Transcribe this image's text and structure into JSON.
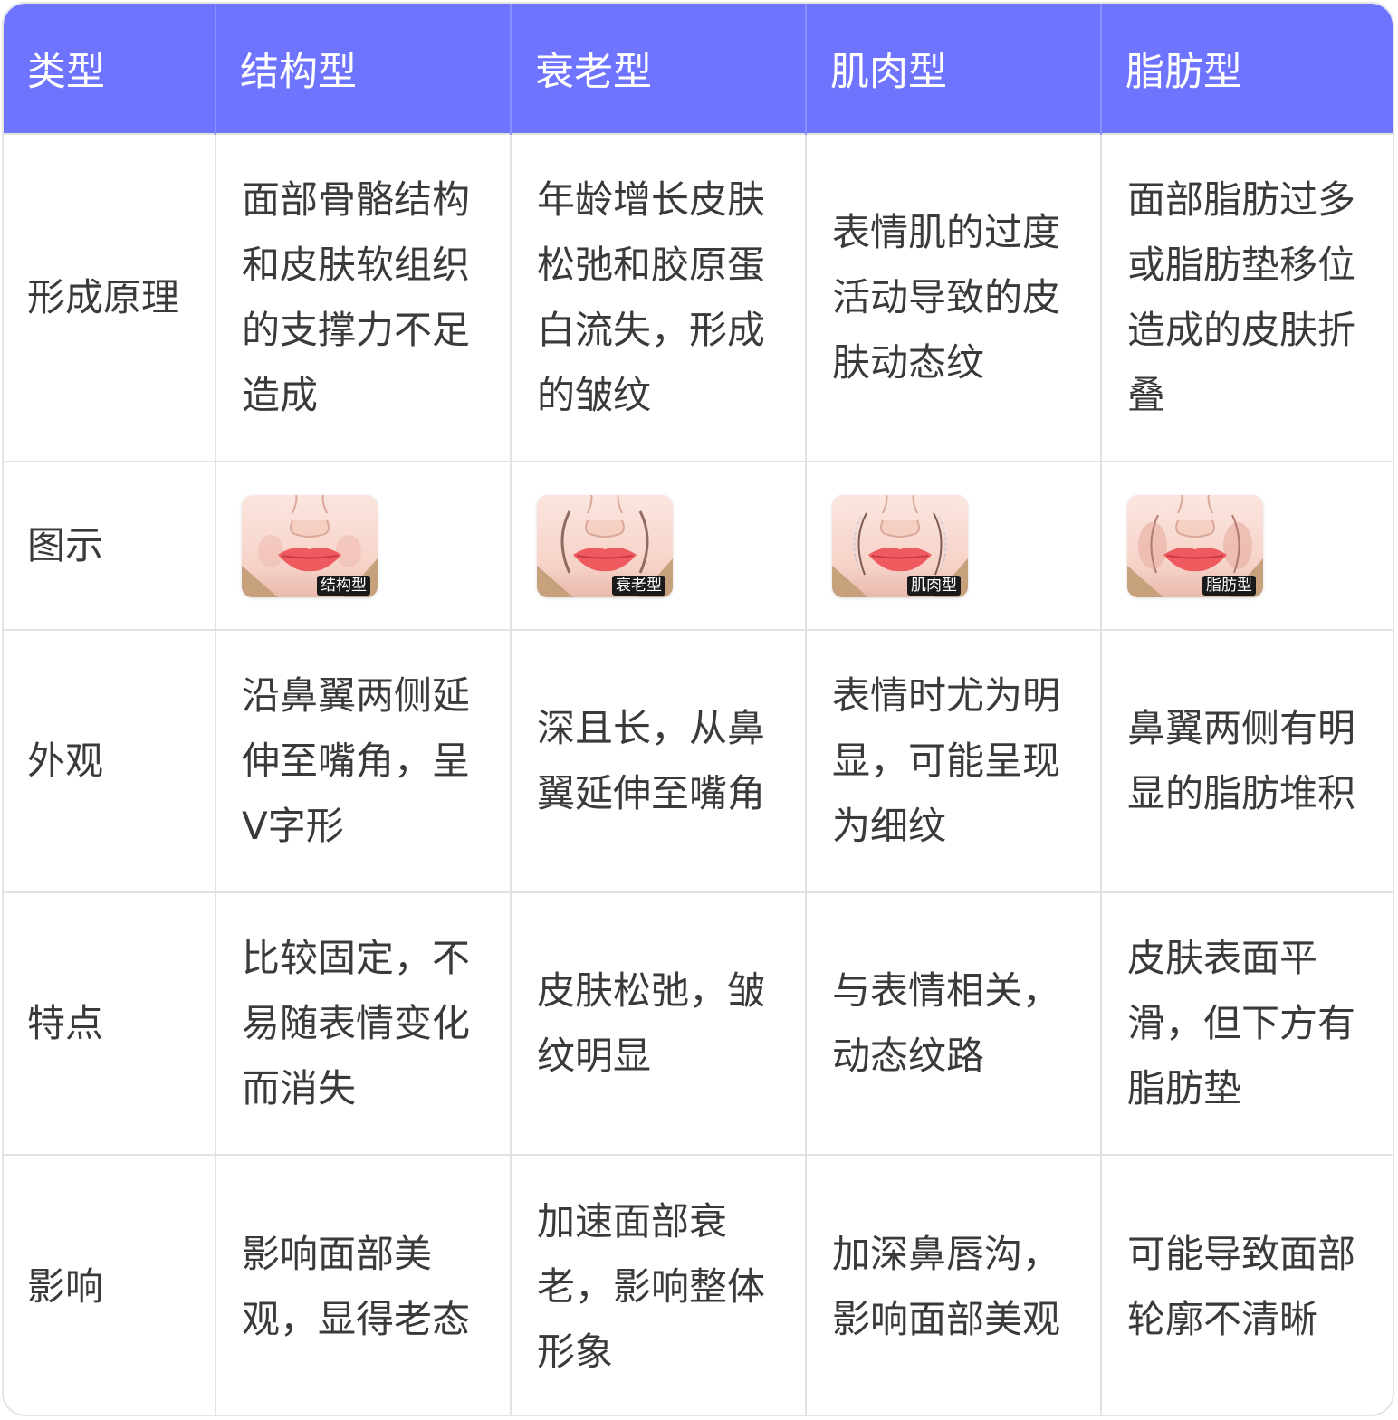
{
  "header": {
    "col0": "类型",
    "col1": "结构型",
    "col2": "衰老型",
    "col3": "肌肉型",
    "col4": "脂肪型"
  },
  "rows": [
    {
      "label": "形成原理",
      "cells": [
        "面部骨骼结构和皮肤软组织的支撑力不足造成",
        "年龄增长皮肤松弛和胶原蛋白流失，形成的皱纹",
        "表情肌的过度活动导致的皮肤动态纹",
        "面部脂肪过多或脂肪垫移位造成的皮肤折叠"
      ]
    },
    {
      "label": "图示",
      "images": [
        {
          "caption": "结构型",
          "icon": "face-structural-icon"
        },
        {
          "caption": "衰老型",
          "icon": "face-aging-icon"
        },
        {
          "caption": "肌肉型",
          "icon": "face-muscular-icon"
        },
        {
          "caption": "脂肪型",
          "icon": "face-fatty-icon"
        }
      ]
    },
    {
      "label": "外观",
      "cells": [
        "沿鼻翼两侧延伸至嘴角，呈V字形",
        "深且长，从鼻翼延伸至嘴角",
        "表情时尤为明显，可能呈现为细纹",
        "鼻翼两侧有明显的脂肪堆积"
      ]
    },
    {
      "label": "特点",
      "cells": [
        "比较固定，不易随表情变化而消失",
        "皮肤松弛，皱纹明显",
        "与表情相关，动态纹路",
        "皮肤表面平滑，但下方有脂肪垫"
      ]
    },
    {
      "label": "影响",
      "cells": [
        "影响面部美观，显得老态",
        "加速面部衰老，影响整体形象",
        "加深鼻唇沟，影响面部美观",
        "可能导致面部轮廓不清晰"
      ]
    }
  ],
  "colors": {
    "header_bg": "#6f74ff",
    "header_text": "#ffffff",
    "body_text": "#3a3a3a",
    "grid": "#e2e2e2",
    "lip": "#ef5a5f"
  }
}
